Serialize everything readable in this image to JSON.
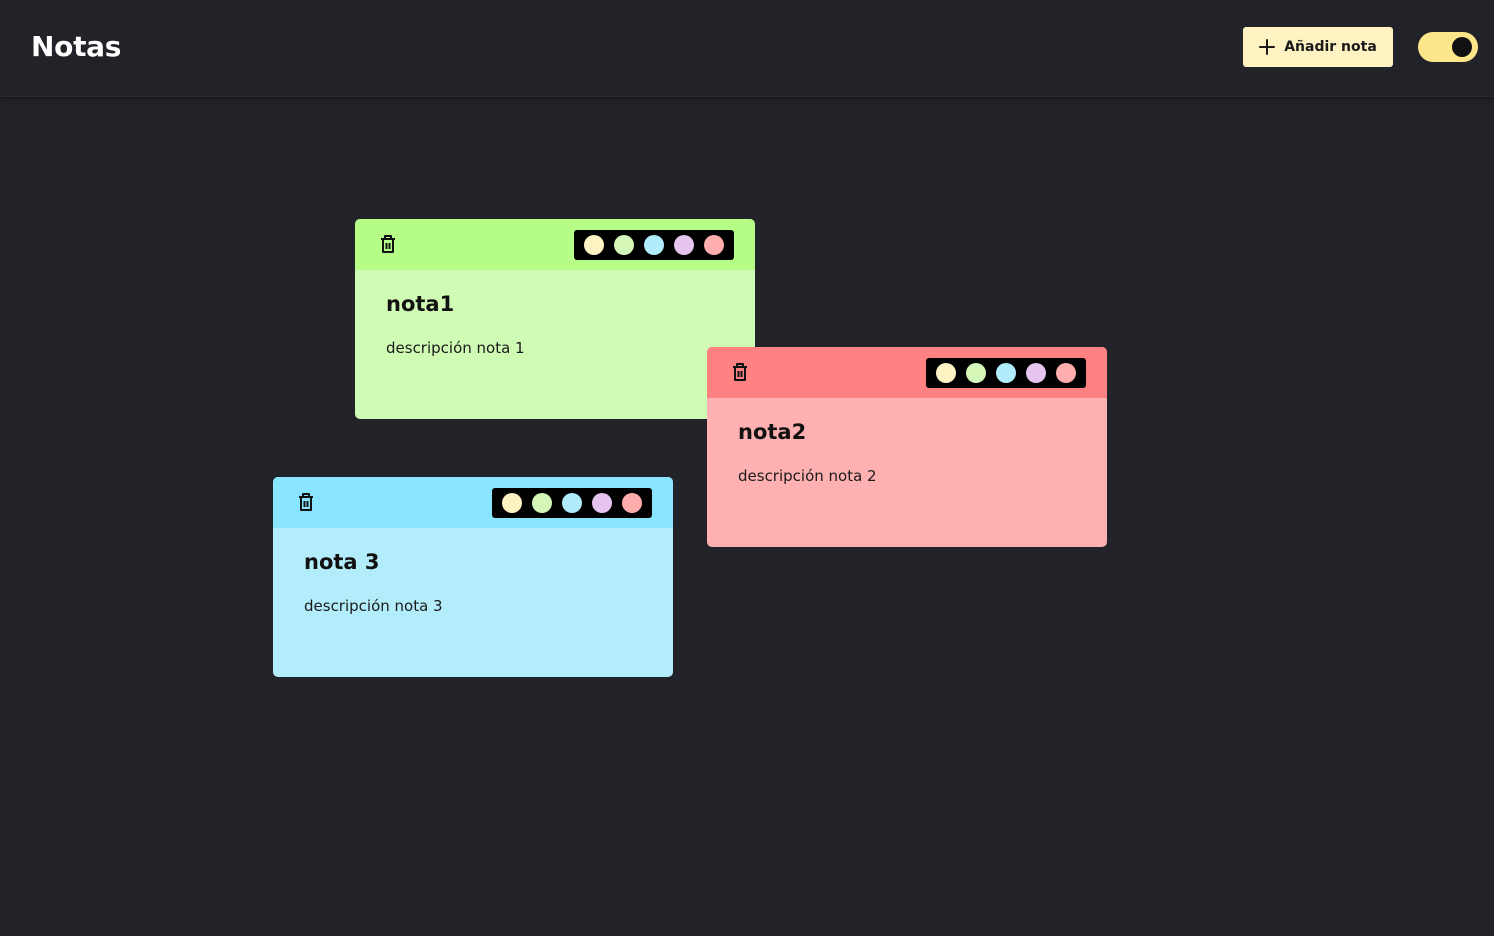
{
  "header": {
    "title": "Notas",
    "add_button_label": "Añadir nota",
    "add_icon": "plus-icon",
    "theme_toggle_color": "#fde68a"
  },
  "palette_colors": [
    "#fff3c4",
    "#d4f7b8",
    "#b0ecfc",
    "#e5c4f0",
    "#ffadad"
  ],
  "notes": [
    {
      "title": "nota1",
      "description": "descripción nota 1",
      "header_color": "#b5fd87",
      "body_color": "#d0fbb4",
      "icon": "trash-icon"
    },
    {
      "title": "nota2",
      "description": "descripción nota 2",
      "header_color": "#ff8181",
      "body_color": "#ffb0b0",
      "icon": "trash-icon"
    },
    {
      "title": "nota 3",
      "description": "descripción nota 3",
      "header_color": "#89e4ff",
      "body_color": "#b3edfc",
      "icon": "trash-icon"
    }
  ]
}
